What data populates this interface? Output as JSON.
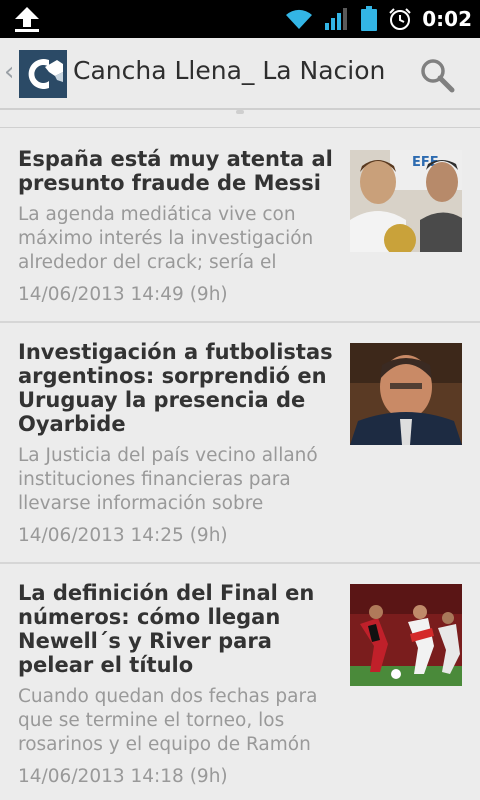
{
  "status_bar": {
    "time": "0:02",
    "icons": [
      "upload-icon",
      "wifi-icon",
      "signal-icon",
      "battery-icon",
      "alarm-icon"
    ]
  },
  "action_bar": {
    "title": "Cancha Llena_ La Nacion",
    "icons": [
      "back-chevron-icon",
      "app-logo",
      "search-icon"
    ]
  },
  "articles": [
    {
      "title": "España está muy atenta al presunto fraude de Messi",
      "summary": "La agenda mediática vive con máximo interés la investigación alrededor del crack; sería el",
      "date": "14/06/2013 14:49 (9h)"
    },
    {
      "title": "Investigación a futbolistas argentinos: sorprendió en Uruguay la presencia de Oyarbide",
      "summary": "La Justicia del país vecino allanó instituciones financieras para llevarse información sobre",
      "date": "14/06/2013 14:25 (9h)"
    },
    {
      "title": "La definición del Final en números: cómo llegan Newell´s y River para pelear el título",
      "summary": "Cuando quedan dos fechas para que se termine el torneo, los rosarinos y el equipo de Ramón",
      "date": "14/06/2013 14:18 (9h)"
    }
  ],
  "colors": {
    "status_bar_bg": "#000000",
    "action_bar_bg": "#ebebeb",
    "accent_icon": "#33b5e5",
    "logo_bg": "#2b4a66",
    "title_text": "#333333",
    "secondary_text": "#999999"
  }
}
